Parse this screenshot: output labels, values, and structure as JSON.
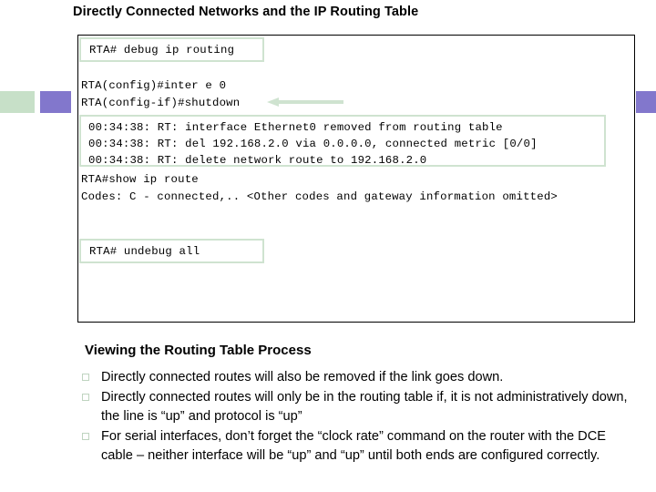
{
  "slide": {
    "title": "Directly Connected Networks and the IP Routing Table"
  },
  "console": {
    "debug_command": "RTA# debug ip routing",
    "config_lines": [
      "RTA(config)#inter e 0",
      "RTA(config-if)#shutdown"
    ],
    "debug_output": [
      "00:34:38: RT: interface Ethernet0 removed from routing table",
      "00:34:38: RT: del 192.168.2.0 via 0.0.0.0, connected metric [0/0]",
      "00:34:38: RT: delete network route to 192.168.2.0"
    ],
    "show_lines": [
      "RTA#show ip route",
      "Codes: C - connected,.. <Other codes and gateway information omitted>"
    ],
    "undebug_command": "RTA# undebug all",
    "annotation_arrow": "left-arrow-pointing-to-shutdown"
  },
  "section": {
    "heading": "Viewing the Routing Table Process",
    "bullets": [
      "Directly connected routes will also be removed if the link goes down.",
      "Directly connected routes will only be in the routing table if, it is not administratively down, the line is “up” and protocol is “up”",
      "For serial interfaces, don’t forget the “clock rate” command on the router with the DCE cable – neither interface will be “up” and “up” until both ends are configured correctly."
    ]
  },
  "decor": {
    "green_bar_color": "#c7e0c8",
    "purple_bar_color": "#8277cc",
    "highlight_border_color": "#cfe3d0",
    "arrow_color": "#cfe3d0"
  }
}
